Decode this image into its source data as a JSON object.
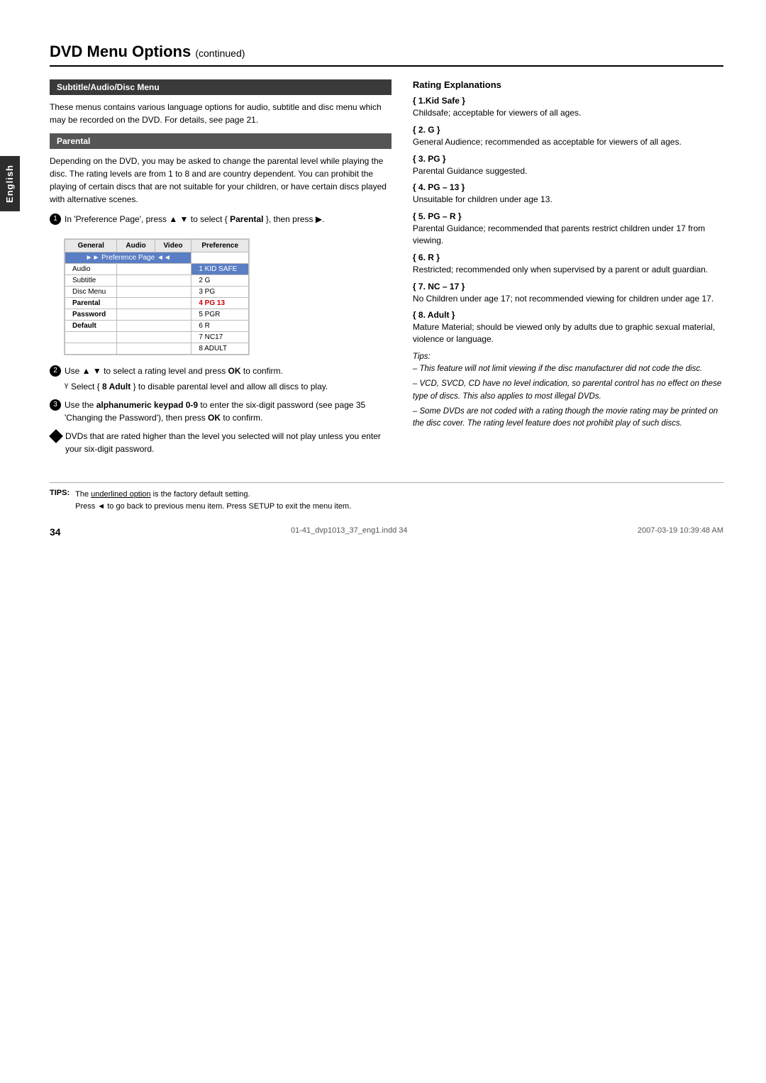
{
  "page": {
    "title": "DVD Menu Options",
    "title_suffix": "continued",
    "page_number": "34",
    "footer_left": "01-41_dvp1013_37_eng1.indd  34",
    "footer_right": "2007-03-19  10:39:48 AM"
  },
  "english_tab": "English",
  "left_col": {
    "subtitle_section": {
      "header": "Subtitle/Audio/Disc Menu",
      "text": "These menus contains various language options for audio, subtitle and disc menu which may be recorded on the DVD. For details, see page 21."
    },
    "parental_section": {
      "header": "Parental",
      "text": "Depending on the DVD, you may be asked to change the parental level while playing the disc. The rating levels are from 1 to 8 and are country dependent. You can prohibit the playing of certain discs that are not suitable for your children, or have certain discs played with alternative scenes.",
      "step1": {
        "num": "1",
        "text": "In 'Preference Page', press ▲ ▼ to select { ",
        "bold": "Parental",
        "text2": " }, then press ▶."
      },
      "table": {
        "headers": [
          "General",
          "Audio",
          "Video",
          "Preference"
        ],
        "pref_row": "►► Preference Page ◄◄",
        "rows": [
          {
            "label": "Audio",
            "value": "1 KID SAFE",
            "highlight": true
          },
          {
            "label": "Subtitle",
            "value": "2 G"
          },
          {
            "label": "Disc Menu",
            "value": "3 PG"
          },
          {
            "label": "Parental",
            "value": "4 PG 13",
            "selected": true
          },
          {
            "label": "Password",
            "value": "5 PGR"
          },
          {
            "label": "Default",
            "value": "6 R"
          },
          {
            "label": "",
            "value": "7 NC17"
          },
          {
            "label": "",
            "value": "8 ADULT"
          }
        ]
      },
      "step2": {
        "num": "2",
        "text": "Use ▲ ▼ to select a rating level and press ",
        "bold": "OK",
        "text2": " to confirm.",
        "sub": "Select { 8 Adult } to disable parental level and allow all discs to play."
      },
      "step3": {
        "num": "3",
        "text1": "Use the ",
        "bold": "alphanumeric keypad 0-9",
        "text2": " to enter the six-digit password (see page 35 'Changing the Password'), then press ",
        "bold2": "OK",
        "text3": " to confirm."
      },
      "step4": {
        "text": "DVDs that are rated higher than the level you selected will not play unless you enter your six-digit password."
      }
    }
  },
  "right_col": {
    "rating_title": "Rating Explanations",
    "ratings": [
      {
        "label": "{ 1.Kid Safe }",
        "desc": "Childsafe; acceptable for viewers of all ages."
      },
      {
        "label": "{ 2. G }",
        "desc": "General Audience; recommended as acceptable for viewers of all ages."
      },
      {
        "label": "{ 3. PG }",
        "desc": "Parental Guidance suggested."
      },
      {
        "label": "{ 4. PG – 13 }",
        "desc": "Unsuitable for children under age 13."
      },
      {
        "label": "{ 5. PG – R }",
        "desc": "Parental Guidance; recommended that parents restrict children under 17 from viewing."
      },
      {
        "label": "{ 6. R }",
        "desc": "Restricted; recommended only when supervised by a parent or adult guardian."
      },
      {
        "label": "{ 7. NC – 17 }",
        "desc": "No Children under age 17; not recommended viewing for children under age 17."
      },
      {
        "label": "{ 8. Adult }",
        "desc": "Mature Material; should be viewed only by adults due to graphic sexual material, violence or language."
      }
    ],
    "tips": [
      "– This feature will not limit viewing if the disc manufacturer did not code the disc.",
      "– VCD, SVCD, CD have no level indication, so parental control has no effect on these type of discs. This also applies to most illegal DVDs.",
      "– Some DVDs are not coded with a rating though the movie rating may be printed on the disc cover. The rating level feature does not prohibit play of such discs."
    ]
  },
  "bottom_tips": {
    "label": "TIPS:",
    "line1_prefix": "The ",
    "line1_underlined": "underlined option",
    "line1_suffix": " is the factory default setting.",
    "line2": "Press ◄ to go back to previous menu item. Press SETUP to exit the menu item."
  }
}
